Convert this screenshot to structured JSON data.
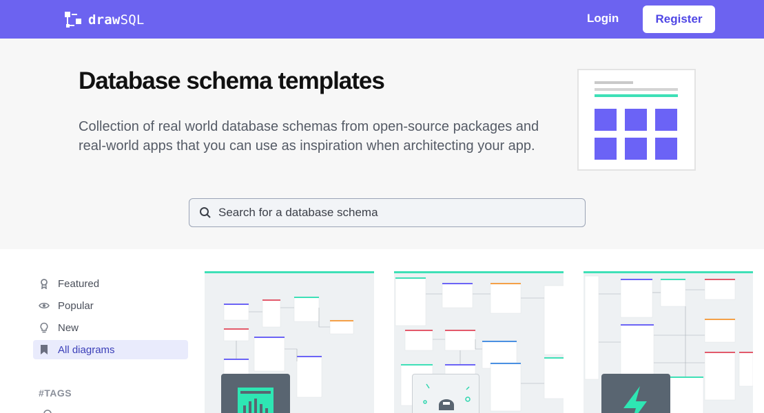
{
  "header": {
    "brand_left": "draw",
    "brand_right": "SQL",
    "login_label": "Login",
    "register_label": "Register"
  },
  "hero": {
    "title": "Database schema templates",
    "description": "Collection of real world database schemas from open-source packages and real-world apps that you can use as inspiration when architecting your app.",
    "search_placeholder": "Search for a database schema"
  },
  "sidebar": {
    "items": [
      {
        "label": "Featured",
        "icon": "award-icon",
        "active": false
      },
      {
        "label": "Popular",
        "icon": "eye-icon",
        "active": false
      },
      {
        "label": "New",
        "icon": "lightbulb-icon",
        "active": false
      },
      {
        "label": "All diagrams",
        "icon": "bookmark-icon",
        "active": true
      }
    ],
    "tags_heading": "#TAGS"
  },
  "colors": {
    "header_bg": "#6c63f0",
    "accent": "#4f46e5",
    "card_top_border": "#3ee0b7",
    "illustration_blocks": "#6b63f6"
  }
}
